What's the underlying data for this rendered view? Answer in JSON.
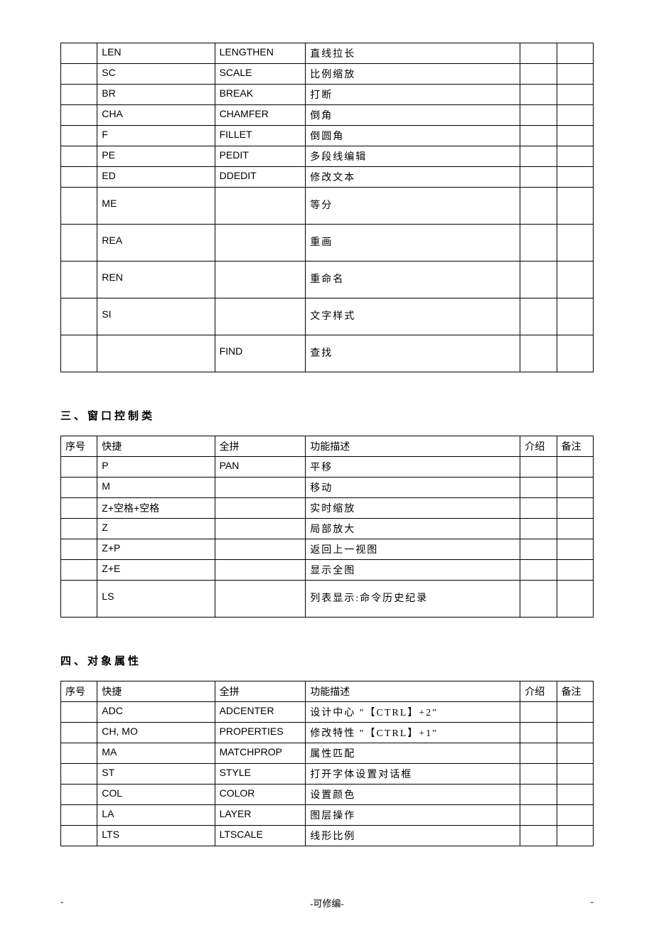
{
  "table1": {
    "rows": [
      {
        "kj": "LEN",
        "qp": "LENGTHEN",
        "desc": "直线拉长",
        "tall": false
      },
      {
        "kj": "SC",
        "qp": "SCALE",
        "desc": "比例缩放",
        "tall": false
      },
      {
        "kj": "BR",
        "qp": "BREAK",
        "desc": "打断",
        "tall": false
      },
      {
        "kj": "CHA",
        "qp": "CHAMFER",
        "desc": "倒角",
        "tall": false
      },
      {
        "kj": "F",
        "qp": "FILLET",
        "desc": "倒圆角",
        "tall": false
      },
      {
        "kj": "PE",
        "qp": "PEDIT",
        "desc": "多段线编辑",
        "tall": false
      },
      {
        "kj": "ED",
        "qp": "DDEDIT",
        "desc": "修改文本",
        "tall": false
      },
      {
        "kj": "ME",
        "qp": "",
        "desc": "等分",
        "tall": true
      },
      {
        "kj": "REA",
        "qp": "",
        "desc": "重画",
        "tall": true
      },
      {
        "kj": "REN",
        "qp": "",
        "desc": "重命名",
        "tall": true
      },
      {
        "kj": "SI",
        "qp": "",
        "desc": "文字样式",
        "tall": true
      },
      {
        "kj": "",
        "qp": "FIND",
        "desc": "查找",
        "tall": true
      }
    ]
  },
  "section2": {
    "title": "三、窗口控制类",
    "headers": {
      "seq": "序号",
      "kj": "快捷",
      "qp": "全拼",
      "desc": "功能描述",
      "jie": "介绍",
      "bei": "备注"
    },
    "rows": [
      {
        "kj": "P",
        "qp": "PAN",
        "desc": "平移",
        "tall": false
      },
      {
        "kj": "M",
        "qp": "",
        "desc": "移动",
        "tall": false
      },
      {
        "kj": "Z+空格+空格",
        "qp": "",
        "desc": "实时缩放",
        "tall": false
      },
      {
        "kj": "Z",
        "qp": "",
        "desc": "局部放大",
        "tall": false
      },
      {
        "kj": "Z+P",
        "qp": "",
        "desc": "返回上一视图",
        "tall": false
      },
      {
        "kj": "Z+E",
        "qp": "",
        "desc": "显示全图",
        "tall": false
      },
      {
        "kj": "LS",
        "qp": "",
        "desc": "列表显示:命令历史纪录",
        "tall": true
      }
    ]
  },
  "section3": {
    "title": "四、对象属性",
    "headers": {
      "seq": "序号",
      "kj": "快捷",
      "qp": "全拼",
      "desc": "功能描述",
      "jie": "介绍",
      "bei": "备注"
    },
    "rows": [
      {
        "kj": "ADC",
        "qp": "ADCENTER",
        "desc": "设计中心 \"【CTRL】+2\""
      },
      {
        "kj": "CH, MO",
        "qp": "PROPERTIES",
        "desc": "修改特性 \"【CTRL】+1\""
      },
      {
        "kj": "MA",
        "qp": "MATCHPROP",
        "desc": "属性匹配"
      },
      {
        "kj": "ST",
        "qp": "STYLE",
        "desc": "打开字体设置对话框"
      },
      {
        "kj": "COL",
        "qp": "COLOR",
        "desc": "设置颜色"
      },
      {
        "kj": "LA",
        "qp": "LAYER",
        "desc": "图层操作"
      },
      {
        "kj": "LTS",
        "qp": "LTSCALE",
        "desc": "线形比例"
      }
    ]
  },
  "footer": {
    "left": "-",
    "center": "-可修编-",
    "right": "-"
  }
}
